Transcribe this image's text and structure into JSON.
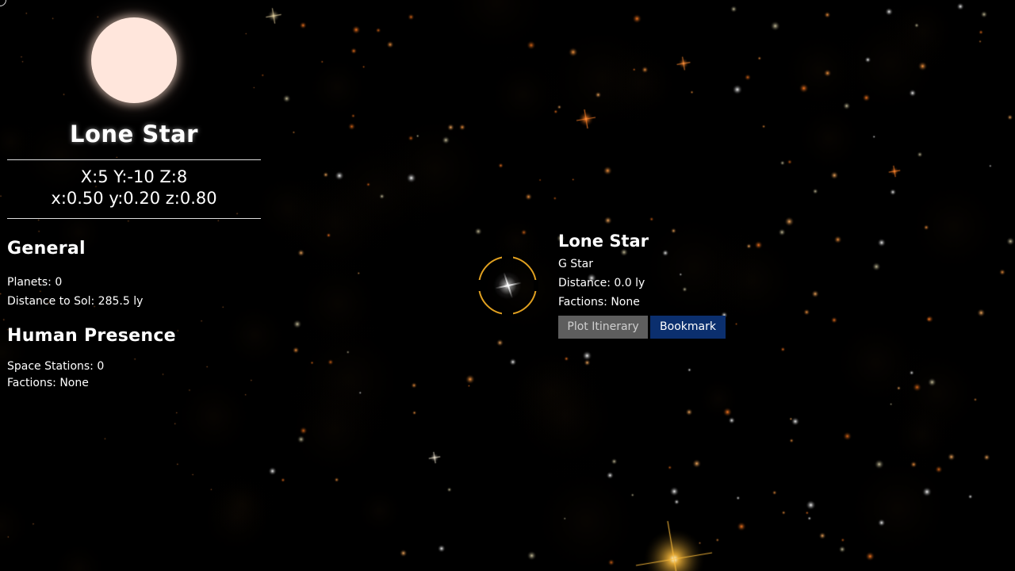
{
  "system_panel": {
    "star_name": "Lone Star",
    "coords_grid": "X:5 Y:-10 Z:8",
    "coords_local": "x:0.50 y:0.20 z:0.80",
    "general": {
      "heading": "General",
      "planets": "Planets: 0",
      "distance_to_sol": "Distance to Sol: 285.5 ly"
    },
    "human_presence": {
      "heading": "Human Presence",
      "space_stations": "Space Stations: 0",
      "factions": "Factions: None"
    }
  },
  "tooltip": {
    "star_name": "Lone Star",
    "star_class": "G Star",
    "distance": "Distance: 0.0 ly",
    "factions": "Factions: None",
    "plot_button": "Plot Itinerary",
    "bookmark_button": "Bookmark"
  },
  "colors": {
    "reticle": "#e0a020",
    "star_orb": "#ffe6dc",
    "bookmark_button_bg": "#0b2f6e",
    "plot_button_bg": "#5e5e5e"
  },
  "icons": {
    "reticle": "selection-reticle-icon",
    "star": "star-sprite-icon"
  }
}
